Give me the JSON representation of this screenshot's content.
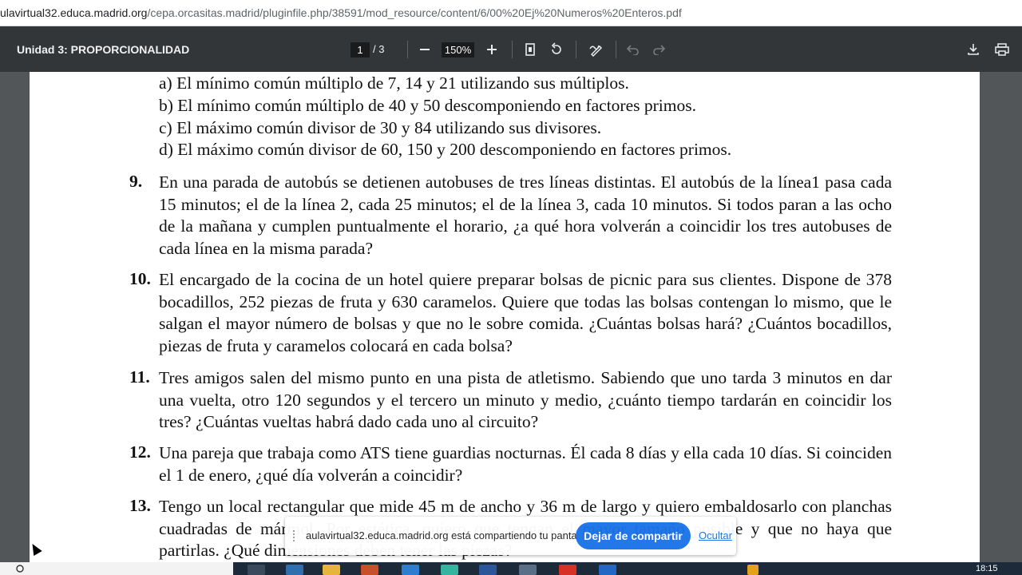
{
  "address_bar": {
    "url_host": "ulavirtual32.educa.madrid.org",
    "url_path": "/cepa.orcasitas.madrid/pluginfile.php/38591/mod_resource/content/6/00%20Ej%20Numeros%20Enteros.pdf"
  },
  "toolbar": {
    "title": "Unidad 3: PROPORCIONALIDAD",
    "page_current": "1",
    "page_total": "/  3",
    "zoom": "150%"
  },
  "document": {
    "sub_items": [
      "a) El mínimo común múltiplo de 7, 14 y 21 utilizando sus múltiplos.",
      "b) El mínimo común múltiplo de 40 y 50 descomponiendo en factores primos.",
      "c) El máximo común divisor de 30 y 84 utilizando sus divisores.",
      "d) El máximo común divisor de 60, 150 y 200 descomponiendo en factores primos."
    ],
    "items": [
      {
        "num": "9.",
        "text": "En una parada de autobús se detienen autobuses de tres líneas distintas. El autobús de la línea1 pasa cada 15 minutos; el de la línea 2, cada 25 minutos; el de la línea 3, cada 10 minutos. Si todos paran a las ocho de la mañana y cumplen puntualmente el horario, ¿a qué hora volverán a coincidir los tres autobuses de cada línea en la misma parada?"
      },
      {
        "num": "10.",
        "text": "El encargado de la cocina de un hotel quiere preparar bolsas de picnic para sus clientes. Dispone de 378 bocadillos, 252 piezas de fruta y 630 caramelos. Quiere que todas las bolsas contengan lo mismo, que le salgan el mayor número de bolsas y que no le sobre comida. ¿Cuántas bolsas hará? ¿Cuántos bocadillos, piezas de fruta y caramelos colocará en cada bolsa?"
      },
      {
        "num": "11.",
        "text": "Tres amigos salen del mismo punto en una pista de atletismo. Sabiendo que uno tarda 3 minutos en dar una vuelta, otro 120 segundos y el tercero un minuto y medio, ¿cuánto tiempo tardarán en coincidir los tres? ¿Cuántas vueltas habrá dado cada uno al circuito?"
      },
      {
        "num": "12.",
        "text": "Una pareja que trabaja como ATS tiene guardias nocturnas. Él cada 8 días y ella cada 10 días. Si coinciden el 1 de enero, ¿qué día volverán a coincidir?"
      },
      {
        "num": "13.",
        "text": "Tengo un local rectangular que mide 45 m de ancho y 36 m de largo y quiero embaldosarlo con planchas cuadradas de mármol. Por estética, quiero que tengan el mayor tamaño posible y que no haya que partirlas. ¿Qué dimensiones deben tener las piezas?"
      }
    ]
  },
  "share_bar": {
    "message": "aulavirtual32.educa.madrid.org está compartiendo tu pantalla.",
    "stop_label": "Dejar de compartir",
    "hide_label": "Ocultar"
  },
  "taskbar": {
    "clock": "18:15"
  },
  "colors": {
    "toolbar_bg": "#323639",
    "viewer_bg": "#525659",
    "accent": "#1a73e8"
  }
}
